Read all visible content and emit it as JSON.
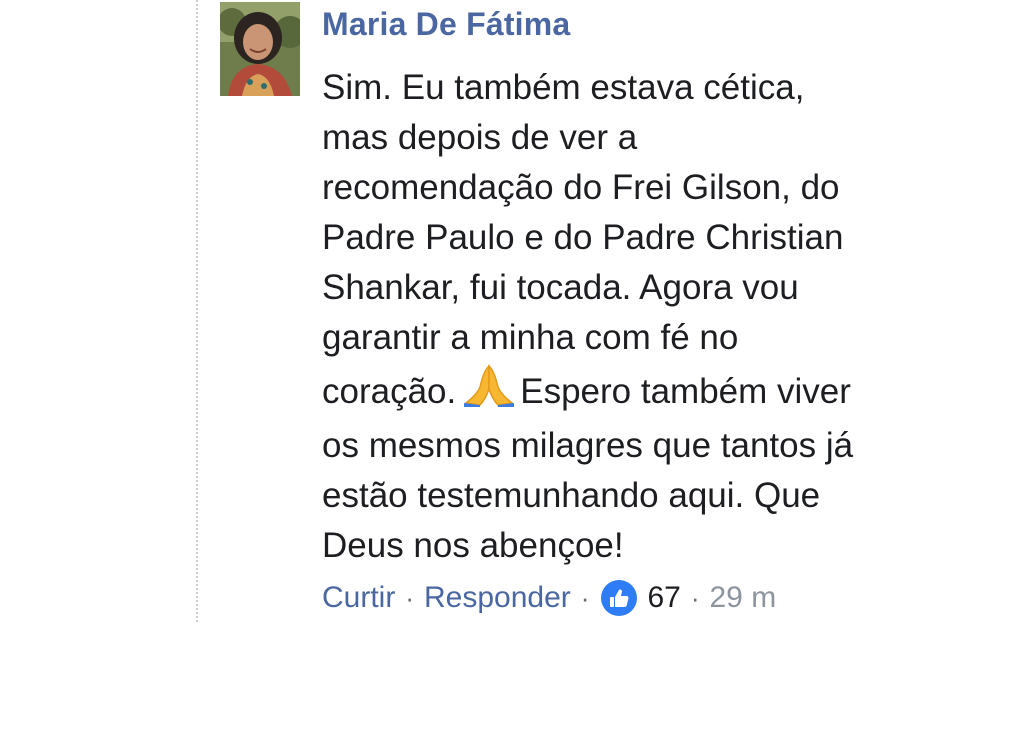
{
  "comment": {
    "author": "Maria De Fátima",
    "lines": [
      "Sim. Eu também estava cética,",
      "mas depois de ver a",
      "recomendação do Frei Gilson, do",
      "Padre Paulo e do Padre Christian",
      "Shankar, fui tocada. Agora vou",
      "garantir a minha com fé no"
    ],
    "line_emoji_before": "coração.",
    "line_emoji_after": "Espero também viver",
    "lines_after": [
      "os mesmos milagres que tantos já",
      "estão testemunhando aqui. Que",
      "Deus nos abençoe!"
    ]
  },
  "actions": {
    "like_label": "Curtir",
    "separator": "·",
    "reply_label": "Responder",
    "reaction_count": "67",
    "timestamp": "29 m"
  },
  "icons": {
    "avatar": "profile-photo",
    "emoji": "folded-hands-emoji",
    "reaction": "thumbs-up-icon"
  },
  "colors": {
    "author": "#4b67a1",
    "link": "#4b67a1",
    "text": "#1c1e21",
    "muted": "#8d949e",
    "like_badge": "#2e7cf6"
  }
}
